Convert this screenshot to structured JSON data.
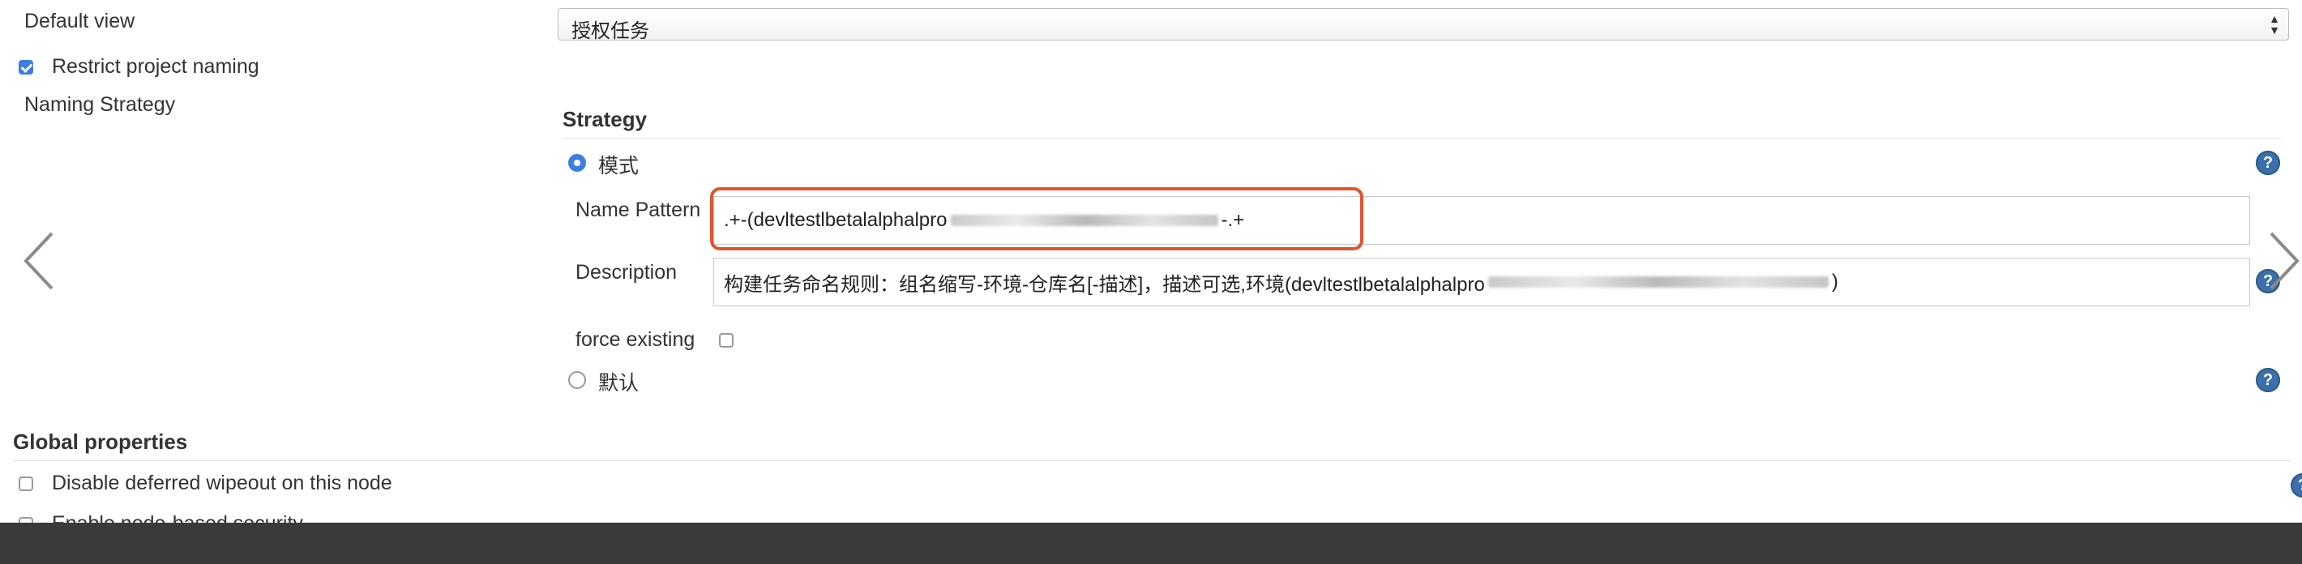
{
  "default_view": {
    "label": "Default view",
    "selected": "授权任务"
  },
  "restrict_naming": {
    "label": "Restrict project naming",
    "checked": true
  },
  "naming_strategy": {
    "label": "Naming Strategy",
    "section_title": "Strategy",
    "pattern_option": "模式",
    "default_option": "默认",
    "name_pattern": {
      "label": "Name Pattern",
      "value_start": ".+-(devltestlbetalalphalpro",
      "value_end": "-.+"
    },
    "description": {
      "label": "Description",
      "value_start": "构建任务命名规则：组名缩写-环境-仓库名[-描述]，描述可选,环境(devltestlbetalalphalpro",
      "value_end": ")"
    },
    "force_existing": {
      "label": "force existing",
      "checked": false
    }
  },
  "global_properties": {
    "title": "Global properties",
    "items": [
      {
        "label": "Disable deferred wipeout on this node",
        "checked": false
      },
      {
        "label": "Enable node-based security",
        "checked": false
      }
    ]
  },
  "icons": {
    "help": "help-icon",
    "prev": "chevron-left-icon",
    "next": "chevron-right-icon",
    "select_arrows": "select-arrows-icon"
  },
  "colors": {
    "accent": "#3d7ee0",
    "highlight_border": "#e0552f",
    "bottom_bar": "#3a3a3a"
  }
}
